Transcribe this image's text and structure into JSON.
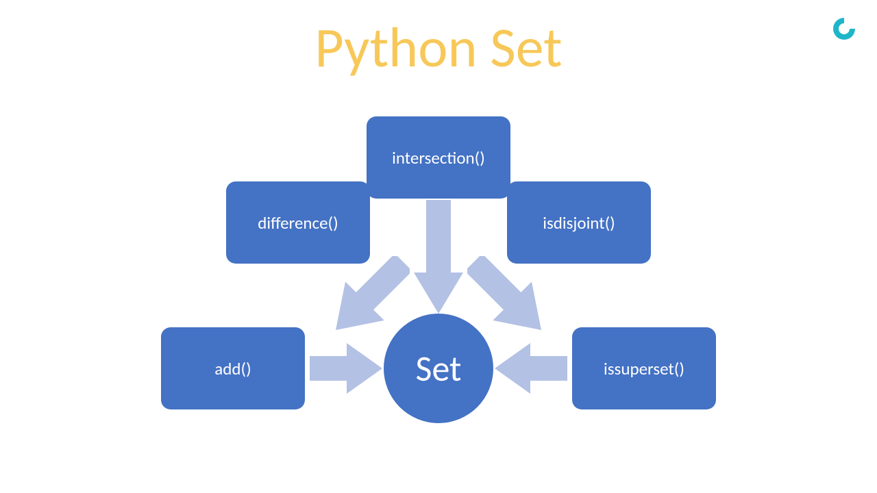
{
  "title": "Python Set",
  "center": "Set",
  "nodes": {
    "intersection": "intersection()",
    "difference": "difference()",
    "isdisjoint": "isdisjoint()",
    "add": "add()",
    "issuperset": "issuperset()"
  },
  "colors": {
    "node_fill": "#4472c4",
    "arrow_fill": "#b3c1e4",
    "title": "#f7c859",
    "logo": "#1fb5c9"
  }
}
